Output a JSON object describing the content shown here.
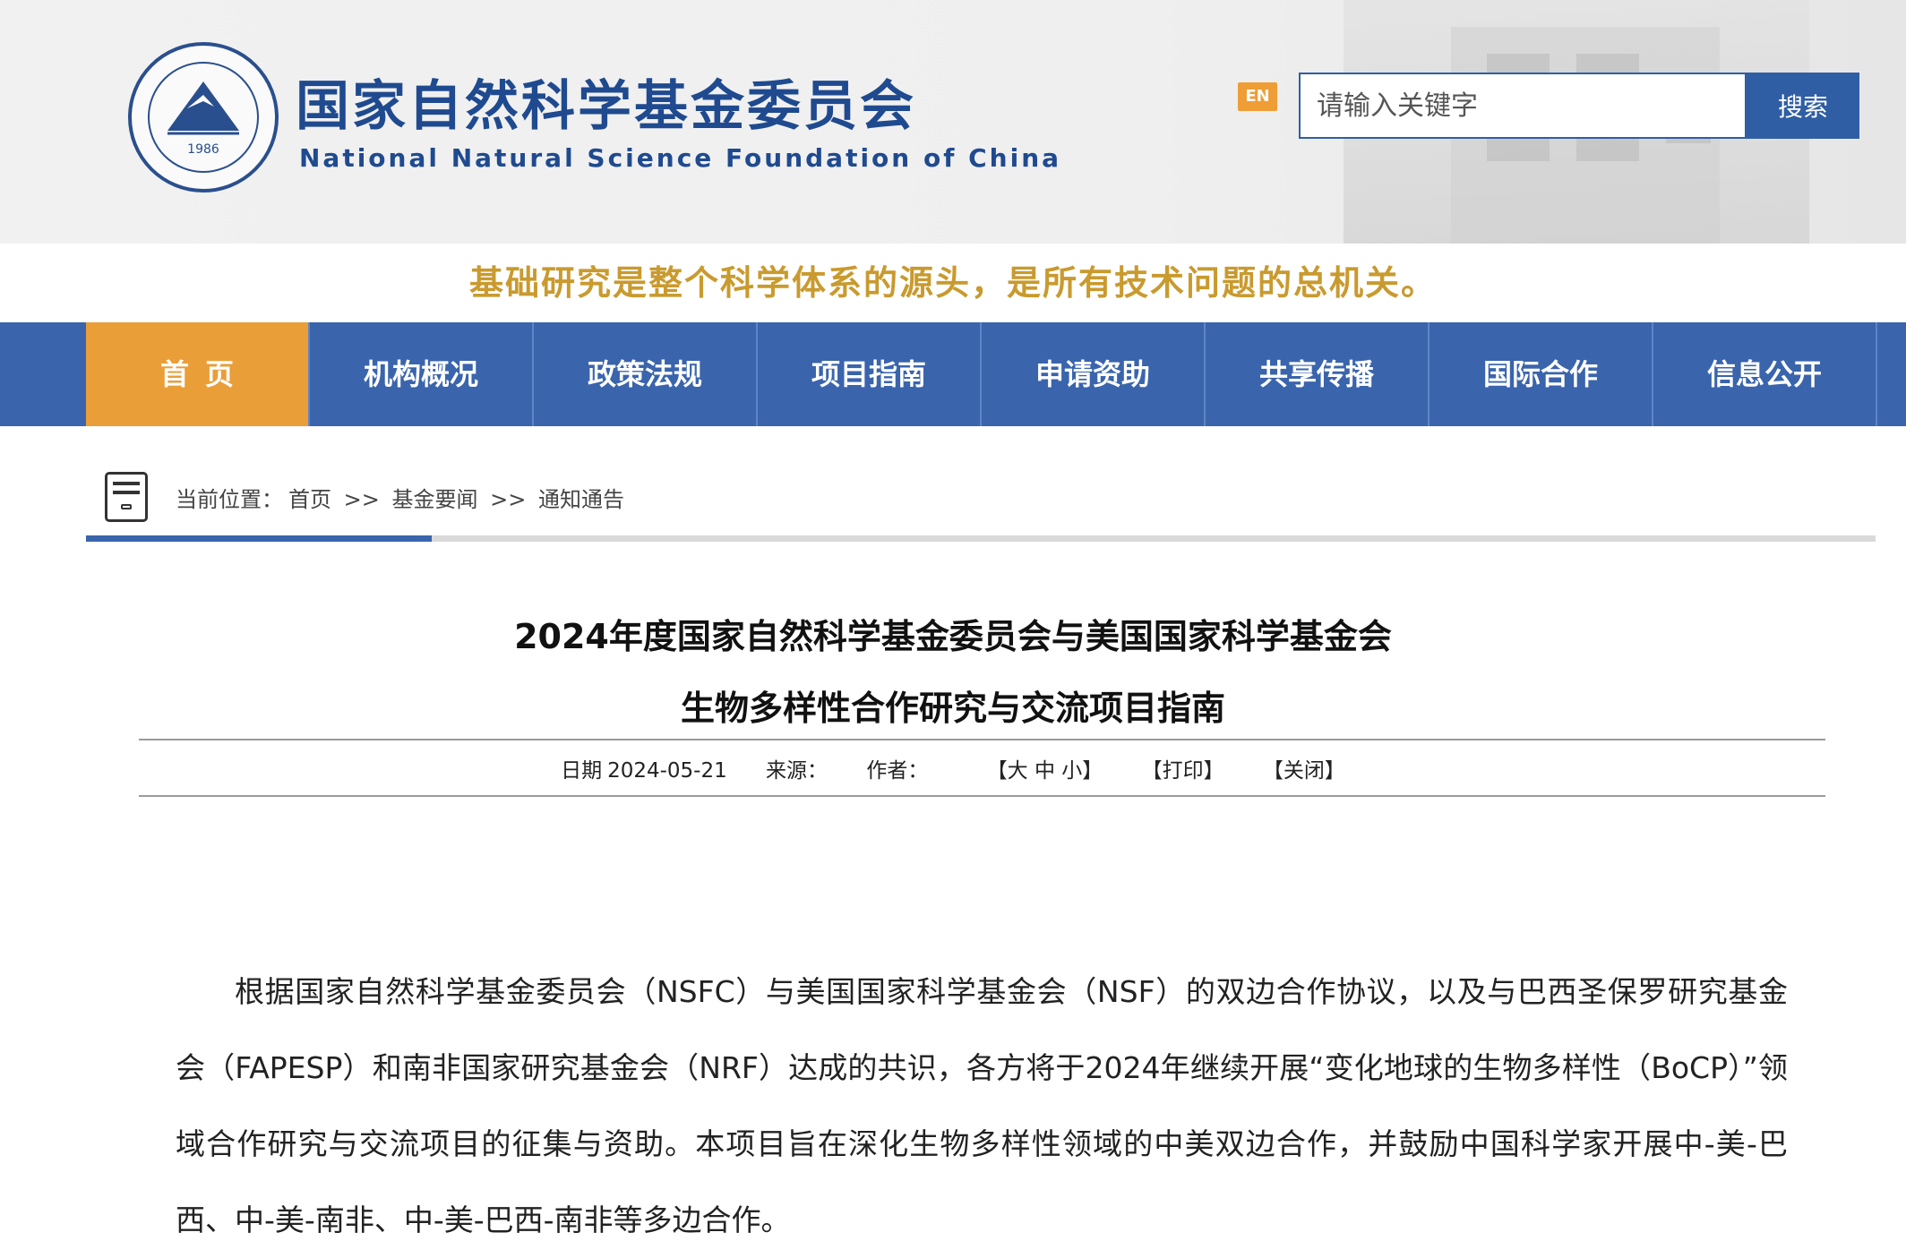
{
  "header": {
    "title_cn": "国家自然科学基金委员会",
    "title_en": "National Natural Science Foundation of China",
    "seal_year": "1986",
    "en_label": "EN",
    "search_placeholder": "请输入关键字",
    "search_button": "搜索"
  },
  "slogan": "基础研究是整个科学体系的源头，是所有技术问题的总机关。",
  "nav": {
    "items": [
      "首页",
      "机构概况",
      "政策法规",
      "项目指南",
      "申请资助",
      "共享传播",
      "国际合作",
      "信息公开"
    ]
  },
  "breadcrumb": {
    "prefix": "当前位置：",
    "items": [
      "首页",
      "基金要闻",
      "通知通告"
    ],
    "separator": ">>"
  },
  "article": {
    "title_line1": "2024年度国家自然科学基金委员会与美国国家科学基金会",
    "title_line2": "生物多样性合作研究与交流项目指南",
    "date_label": "日期",
    "date": "2024-05-21",
    "source_label": "来源：",
    "author_label": "作者：",
    "font_size_ctrl": "【大 中 小】",
    "print_ctrl": "【打印】",
    "close_ctrl": "【关闭】",
    "paragraph": "根据国家自然科学基金委员会（NSFC）与美国国家科学基金会（NSF）的双边合作协议，以及与巴西圣保罗研究基金会（FAPESP）和南非国家研究基金会（NRF）达成的共识，各方将于2024年继续开展“变化地球的生物多样性（BoCP）”领域合作研究与交流项目的征集与资助。本项目旨在深化生物多样性领域的中美双边合作，并鼓励中国科学家开展中-美-巴西、中-美-南非、中-美-巴西-南非等多边合作。"
  },
  "colors": {
    "brand_blue": "#3a64ac",
    "nav_active": "#ea9e38",
    "slogan_gold": "#c99a2e"
  }
}
